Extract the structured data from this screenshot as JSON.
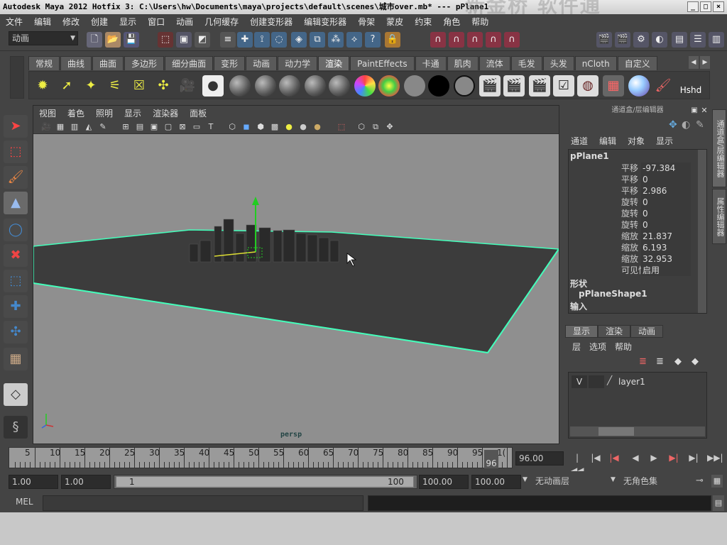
{
  "window": {
    "title": "Autodesk Maya 2012 Hotfix 3: C:\\Users\\hw\\Documents\\maya\\projects\\default\\scenes\\城市over.mb*   ---   pPlane1",
    "watermark": "新金桥 软件通",
    "buttons": [
      "_",
      "□",
      "×"
    ]
  },
  "menubar": [
    "文件",
    "编辑",
    "修改",
    "创建",
    "显示",
    "窗口",
    "动画",
    "几何缓存",
    "创建变形器",
    "编辑变形器",
    "骨架",
    "蒙皮",
    "约束",
    "角色",
    "帮助"
  ],
  "statusline": {
    "mode": "动画"
  },
  "shelf": {
    "tabs": [
      "常规",
      "曲线",
      "曲面",
      "多边形",
      "细分曲面",
      "变形",
      "动画",
      "动力学",
      "渲染",
      "PaintEffects",
      "卡通",
      "肌肉",
      "流体",
      "毛发",
      "头发",
      "nCloth",
      "自定义"
    ],
    "active_tab": "渲染",
    "last_icon_label": "Hshd"
  },
  "viewport": {
    "menu": [
      "视图",
      "着色",
      "照明",
      "显示",
      "渲染器",
      "面板"
    ],
    "camera_label": "persp"
  },
  "channelbox": {
    "header": "通道盒/层编辑器",
    "menu": [
      "通道",
      "编辑",
      "对象",
      "显示"
    ],
    "object_name": "pPlane1",
    "attributes": [
      {
        "label": "平移 X",
        "value": "-97.384"
      },
      {
        "label": "平移 Y",
        "value": "0"
      },
      {
        "label": "平移 Z",
        "value": "2.986"
      },
      {
        "label": "旋转 X",
        "value": "0"
      },
      {
        "label": "旋转 Y",
        "value": "0"
      },
      {
        "label": "旋转 Z",
        "value": "0"
      },
      {
        "label": "缩放 X",
        "value": "21.837"
      },
      {
        "label": "缩放 Y",
        "value": "6.193"
      },
      {
        "label": "缩放 Z",
        "value": "32.953"
      },
      {
        "label": "可见性",
        "value": "启用"
      }
    ],
    "shapes_label": "形状",
    "shape_name": "pPlaneShape1",
    "inputs_label": "输入"
  },
  "layer_editor": {
    "tabs": [
      "显示",
      "渲染",
      "动画"
    ],
    "menu": [
      "层",
      "选项",
      "帮助"
    ],
    "layer": {
      "visible": "V",
      "name": "layer1"
    }
  },
  "side_tabs": [
    "通道盒/层编辑器",
    "属性编辑器"
  ],
  "timeslider": {
    "ticks": [
      "5",
      "10",
      "15",
      "20",
      "25",
      "30",
      "35",
      "40",
      "45",
      "50",
      "55",
      "60",
      "65",
      "70",
      "75",
      "80",
      "85",
      "90",
      "95",
      "1("
    ],
    "current_frame": "96",
    "current_frame_field": "96.00"
  },
  "range": {
    "start_time": "1.00",
    "start_range": "1.00",
    "slider_start": "1",
    "slider_end": "100",
    "end_range": "100.00",
    "end_time": "100.00",
    "anim_layer": "无动画层",
    "character_set": "无角色集"
  },
  "cmdline": {
    "label": "MEL"
  }
}
